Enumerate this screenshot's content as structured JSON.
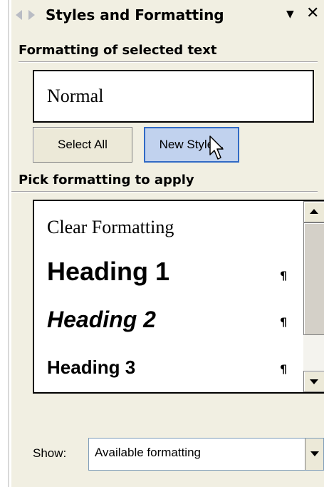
{
  "pane": {
    "title": "Styles and Formatting",
    "menu_glyph": "▼",
    "close_glyph": "✕",
    "back_icon": "back-arrow-icon",
    "forward_icon": "forward-arrow-icon"
  },
  "formatting_section": {
    "header": "Formatting of selected text",
    "current_style": "Normal",
    "select_all_label": "Select All",
    "new_style_label": "New Style..."
  },
  "pick_section": {
    "header": "Pick formatting to apply",
    "items": [
      {
        "label": "Clear Formatting",
        "mark": ""
      },
      {
        "label": "Heading 1",
        "mark": "¶"
      },
      {
        "label": "Heading 2",
        "mark": "¶"
      },
      {
        "label": "Heading 3",
        "mark": "¶"
      }
    ]
  },
  "show": {
    "label": "Show:",
    "value": "Available formatting"
  },
  "colors": {
    "pane_bg": "#f1efe2",
    "button_bg": "#ece9d8",
    "hover_bg": "#c1d2ee",
    "hover_border": "#316ac5"
  }
}
